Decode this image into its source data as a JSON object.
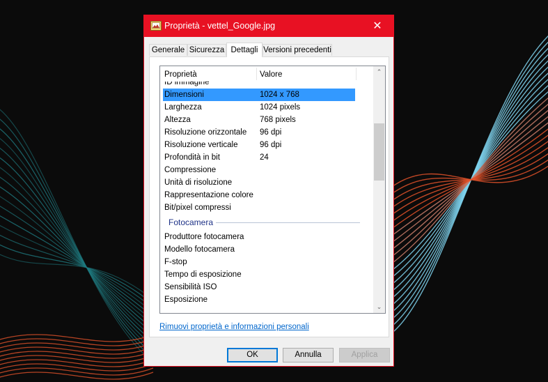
{
  "window": {
    "title": "Proprietà - vettel_Google.jpg",
    "icon": "image-file-icon",
    "close_glyph": "✕",
    "accent_color": "#e81123"
  },
  "tabs": [
    {
      "label": "Generale",
      "active": false
    },
    {
      "label": "Sicurezza",
      "active": false
    },
    {
      "label": "Dettagli",
      "active": true
    },
    {
      "label": "Versioni precedenti",
      "active": false
    }
  ],
  "details": {
    "columns": {
      "property": "Proprietà",
      "value": "Valore"
    },
    "rows": [
      {
        "name": "ID immagine",
        "value": ""
      },
      {
        "name": "Dimensioni",
        "value": "1024 x 768",
        "selected": true
      },
      {
        "name": "Larghezza",
        "value": "1024 pixels"
      },
      {
        "name": "Altezza",
        "value": "768 pixels"
      },
      {
        "name": "Risoluzione orizzontale",
        "value": "96 dpi"
      },
      {
        "name": "Risoluzione verticale",
        "value": "96 dpi"
      },
      {
        "name": "Profondità in bit",
        "value": "24"
      },
      {
        "name": "Compressione",
        "value": ""
      },
      {
        "name": "Unità di risoluzione",
        "value": ""
      },
      {
        "name": "Rappresentazione colore",
        "value": ""
      },
      {
        "name": "Bit/pixel compressi",
        "value": ""
      }
    ],
    "group_label": "Fotocamera",
    "camera_rows": [
      {
        "name": "Produttore fotocamera",
        "value": ""
      },
      {
        "name": "Modello fotocamera",
        "value": ""
      },
      {
        "name": "F-stop",
        "value": ""
      },
      {
        "name": "Tempo di esposizione",
        "value": ""
      },
      {
        "name": "Sensibilità ISO",
        "value": ""
      },
      {
        "name": "Esposizione",
        "value": ""
      }
    ],
    "scroll_up": "⌃",
    "scroll_down": "⌄"
  },
  "remove_link": "Rimuovi proprietà e informazioni personali",
  "buttons": {
    "ok": "OK",
    "cancel": "Annulla",
    "apply": "Applica"
  }
}
